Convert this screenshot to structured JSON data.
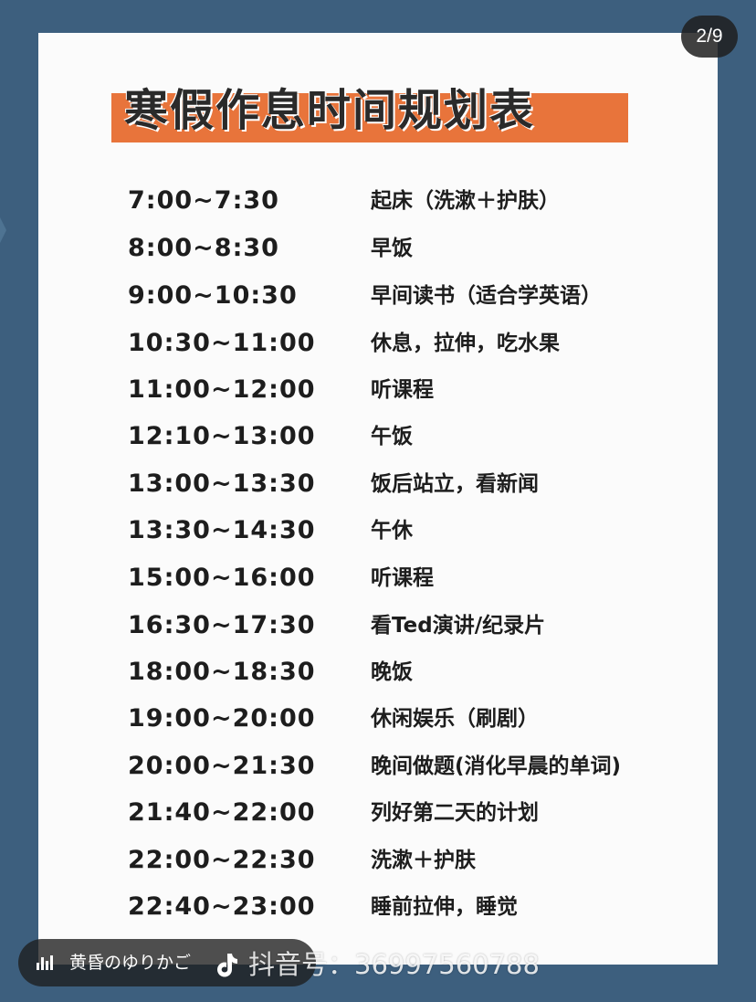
{
  "pager": "2/9",
  "title": "寒假作息时间规划表",
  "schedule": [
    {
      "time": "7:00~7:30",
      "activity": "起床（洗漱＋护肤）"
    },
    {
      "time": "8:00~8:30",
      "activity": "早饭"
    },
    {
      "time": "9:00~10:30",
      "activity": "早间读书（适合学英语）"
    },
    {
      "time": "10:30~11:00",
      "activity": "休息，拉伸，吃水果"
    },
    {
      "time": "11:00~12:00",
      "activity": "听课程"
    },
    {
      "time": "12:10~13:00",
      "activity": "午饭"
    },
    {
      "time": "13:00~13:30",
      "activity": "饭后站立，看新闻"
    },
    {
      "time": "13:30~14:30",
      "activity": "午休"
    },
    {
      "time": "15:00~16:00",
      "activity": "听课程"
    },
    {
      "time": "16:30~17:30",
      "activity": "看Ted演讲/纪录片"
    },
    {
      "time": "18:00~18:30",
      "activity": "晚饭"
    },
    {
      "time": "19:00~20:00",
      "activity": "休闲娱乐（刷剧）"
    },
    {
      "time": "20:00~21:30",
      "activity": "晚间做题(消化早晨的单词)"
    },
    {
      "time": "21:40~22:00",
      "activity": "列好第二天的计划"
    },
    {
      "time": "22:00~22:30",
      "activity": "洗漱＋护肤"
    },
    {
      "time": "22:40~23:00",
      "activity": "睡前拉伸，睡觉"
    }
  ],
  "author": {
    "name": "黄昏のゆりかご",
    "icon": "audio-bars-icon"
  },
  "watermark": "抖音号：36997560788",
  "colors": {
    "background": "#3d5f7e",
    "card": "#fbfbfb",
    "accent": "#e8743b"
  }
}
